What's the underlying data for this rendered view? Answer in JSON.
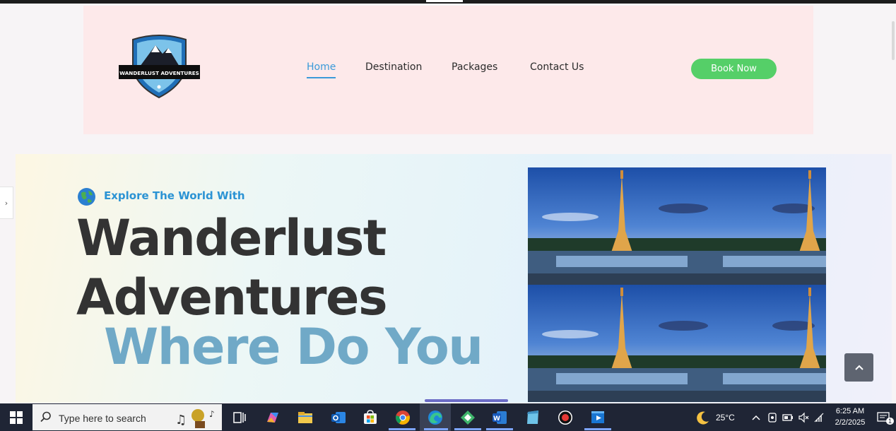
{
  "browser": {
    "side_tab_glyph": "›"
  },
  "header": {
    "logo_text": "WANDERLUST ADVENTURES",
    "nav": [
      {
        "label": "Home",
        "active": true
      },
      {
        "label": "Destination",
        "active": false
      },
      {
        "label": "Packages",
        "active": false
      },
      {
        "label": "Contact Us",
        "active": false
      }
    ],
    "book_button": "Book Now",
    "colors": {
      "header_bg": "#fde9ea",
      "accent": "#3a9ad9",
      "book_bg": "#55cf68"
    }
  },
  "hero": {
    "eyebrow": "Explore The World With",
    "headline_lines": [
      "Wanderlust",
      "Adventures",
      "Where Do You"
    ],
    "icons": {
      "eyebrow_icon": "globe-icon"
    },
    "photos": [
      "eiffel-tower-photo",
      "eiffel-tower-photo",
      "eiffel-tower-photo",
      "eiffel-tower-photo"
    ]
  },
  "scroll_top": {
    "icon": "chevron-up-icon"
  },
  "taskbar": {
    "search_placeholder": "Type here to search",
    "apps": [
      "task-view-icon",
      "copilot-icon",
      "file-explorer-icon",
      "outlook-icon",
      "microsoft-store-icon",
      "chrome-icon",
      "edge-icon",
      "app-icon",
      "word-icon",
      "notepad-icon",
      "record-icon",
      "media-player-icon"
    ],
    "weather": "25°C",
    "time": "6:25 AM",
    "date": "2/2/2025",
    "notification_count": "1"
  }
}
